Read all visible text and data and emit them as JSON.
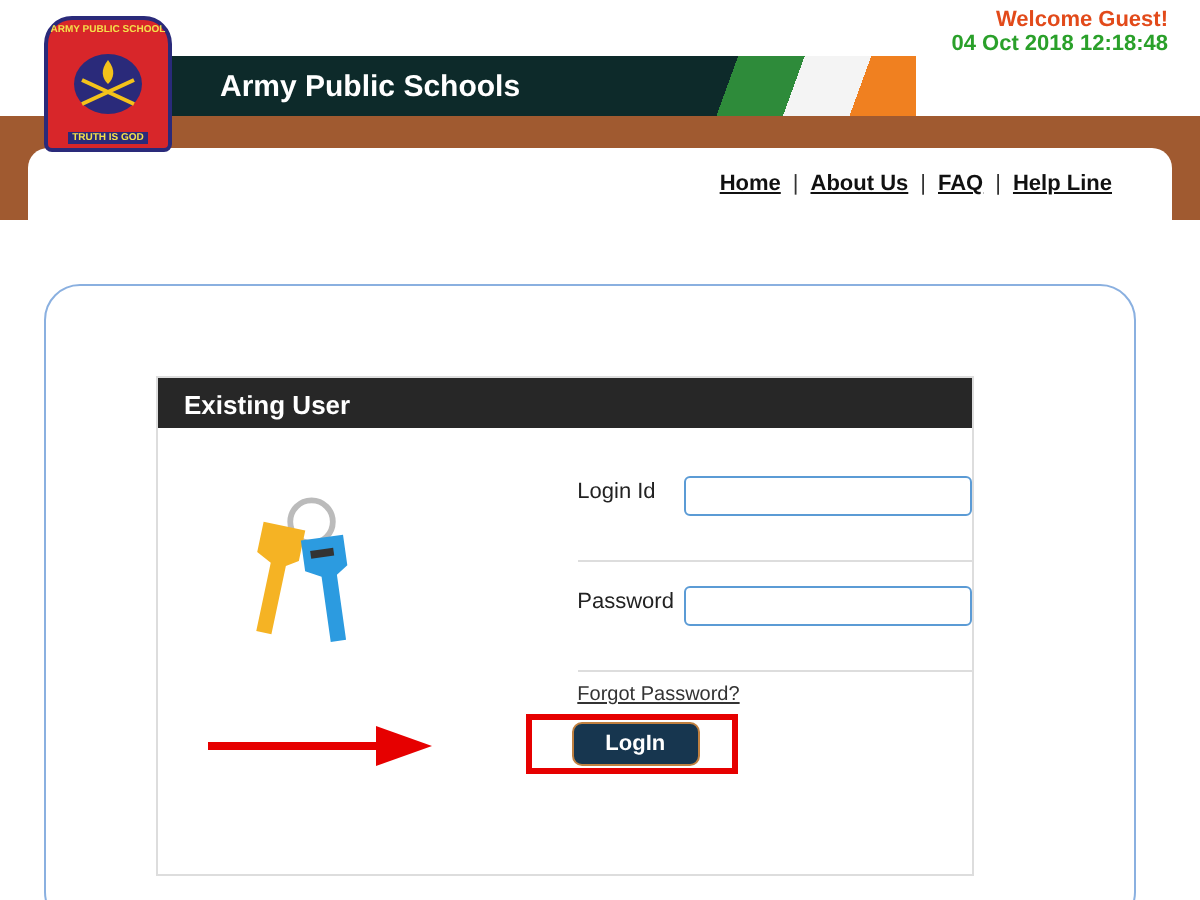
{
  "header": {
    "logo": {
      "top_text": "ARMY PUBLIC SCHOOL",
      "motto": "TRUTH IS GOD"
    },
    "banner_title": "Army Public Schools",
    "welcome": "Welcome Guest!",
    "datetime": "04 Oct 2018 12:18:48"
  },
  "nav": [
    {
      "kind": "link",
      "text": "Home"
    },
    {
      "kind": "separator",
      "text": "|"
    },
    {
      "kind": "link",
      "text": "About Us"
    },
    {
      "kind": "separator",
      "text": "|"
    },
    {
      "kind": "link",
      "text": "FAQ"
    },
    {
      "kind": "separator",
      "text": "|"
    },
    {
      "kind": "link",
      "text": "Help Line"
    }
  ],
  "login": {
    "title": "Existing User",
    "fields": [
      {
        "label": "Login Id"
      },
      {
        "label": "Password"
      }
    ],
    "forgot_link": "Forgot Password?",
    "button": "LogIn"
  }
}
